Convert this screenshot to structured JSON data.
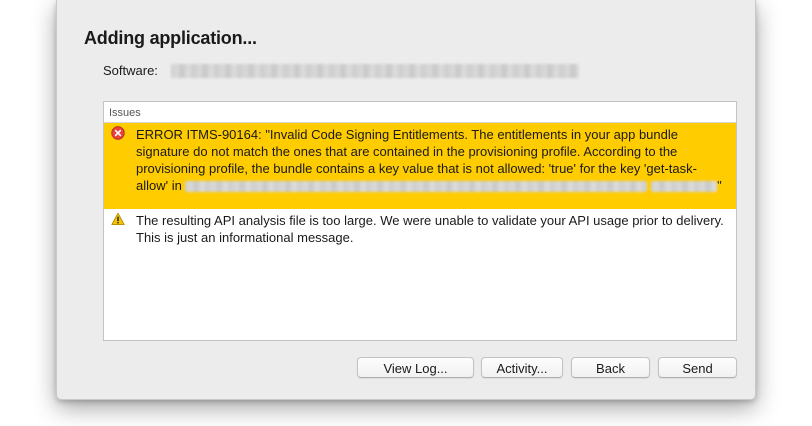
{
  "dialog": {
    "title": "Adding application...",
    "software_label": "Software:"
  },
  "issues": {
    "header": "Issues",
    "items": [
      {
        "type": "error",
        "icon": "error-icon",
        "text_main": "ERROR ITMS-90164: \"Invalid Code Signing Entitlements. The entitlements in your app bundle signature do not match the ones that are contained in the provisioning profile. According to the provisioning profile, the bundle contains a key value that is not allowed: 'true' for the key 'get-task-allow' in",
        "text_end": "\""
      },
      {
        "type": "warning",
        "icon": "warning-icon",
        "text_main": "The resulting API analysis file is too large.  We were unable to validate your API usage prior to delivery.  This is just an informational message."
      }
    ]
  },
  "buttons": {
    "view_log": "View Log...",
    "activity": "Activity...",
    "back": "Back",
    "send": "Send"
  },
  "colors": {
    "error_highlight": "#ffcc00",
    "window_bg": "#ececec"
  }
}
